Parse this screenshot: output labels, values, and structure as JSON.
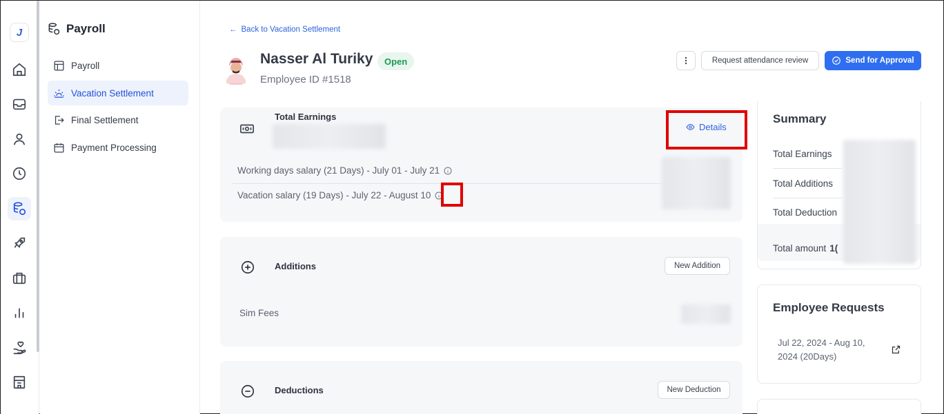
{
  "rail": {
    "logo_letter": "J",
    "icons": [
      "home-icon",
      "inbox-icon",
      "person-icon",
      "clock-icon",
      "payroll-icon",
      "rocket-icon",
      "briefcase-icon",
      "bar-chart-icon",
      "hand-heart-icon",
      "building-icon"
    ],
    "active": "payroll-icon"
  },
  "subnav": {
    "title": "Payroll",
    "items": [
      {
        "label": "Payroll",
        "icon": "table-icon"
      },
      {
        "label": "Vacation Settlement",
        "icon": "sunset-icon",
        "active": true
      },
      {
        "label": "Final Settlement",
        "icon": "exit-icon"
      },
      {
        "label": "Payment Processing",
        "icon": "calendar-icon"
      }
    ]
  },
  "header": {
    "back_label": "Back to Vacation Settlement",
    "employee_name": "Nasser Al Turiky",
    "status": "Open",
    "employee_id": "Employee ID #1518",
    "request_review_label": "Request attendance review",
    "approve_label": "Send for Approval"
  },
  "earnings": {
    "title": "Total Earnings",
    "details_label": "Details",
    "lines": [
      "Working days salary (21 Days) - July 01 - July 21",
      "Vacation salary (19 Days) - July 22 - August 10"
    ]
  },
  "additions": {
    "title": "Additions",
    "new_label": "New Addition",
    "items": [
      "Sim Fees"
    ]
  },
  "deductions": {
    "title": "Deductions",
    "new_label": "New Deduction"
  },
  "summary": {
    "title": "Summary",
    "rows": [
      "Total Earnings",
      "Total Additions",
      "Total Deduction"
    ],
    "total_label": "Total amount",
    "total_partial": "1("
  },
  "requests": {
    "title": "Employee Requests",
    "dates": "Jul 22, 2024 - Aug 10, 2024 (20Days)"
  },
  "colors": {
    "accent": "#2f6ef0",
    "status_green": "#1e9a57",
    "highlight_red": "#e00000"
  }
}
